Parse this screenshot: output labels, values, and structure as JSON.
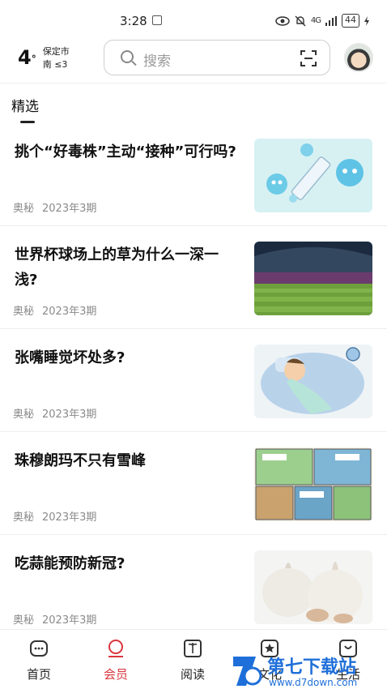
{
  "status_bar": {
    "time": "3:28",
    "signal": "4G",
    "battery": "44"
  },
  "weather": {
    "temp": "4",
    "unit": "°",
    "city": "保定市",
    "wind": "南 ≤3"
  },
  "search": {
    "placeholder": "搜索"
  },
  "tabs": [
    {
      "label": "精选",
      "active": true
    }
  ],
  "articles": [
    {
      "title": "挑个“好毒株”主动“接种”可行吗?",
      "source": "奥秘",
      "issue": "2023年3期",
      "thumb": "virus-syringe-illustration"
    },
    {
      "title": "世界杯球场上的草为什么一深一浅?",
      "source": "奥秘",
      "issue": "2023年3期",
      "thumb": "stadium-photo"
    },
    {
      "title": "张嘴睡觉坏处多?",
      "source": "奥秘",
      "issue": "2023年3期",
      "thumb": "sleeping-boy-illustration"
    },
    {
      "title": "珠穆朗玛不只有雪峰",
      "source": "奥秘",
      "issue": "2023年3期",
      "thumb": "comic-strip"
    },
    {
      "title": "吃蒜能预防新冠?",
      "source": "奥秘",
      "issue": "2023年3期",
      "thumb": "garlic-photo"
    }
  ],
  "bottom_nav": [
    {
      "label": "首页",
      "icon": "home-icon",
      "active": false
    },
    {
      "label": "会员",
      "icon": "member-icon",
      "active": true
    },
    {
      "label": "阅读",
      "icon": "book-icon",
      "active": false
    },
    {
      "label": "文化",
      "icon": "star-icon",
      "active": false
    },
    {
      "label": "生活",
      "icon": "life-icon",
      "active": false
    }
  ],
  "watermark": {
    "text": "第七下载站",
    "url_text": "www.d7down.com"
  },
  "colors": {
    "accent": "#d9363e",
    "text": "#111111",
    "meta": "#8a8a8a",
    "watermark": "#1e6fd9"
  }
}
